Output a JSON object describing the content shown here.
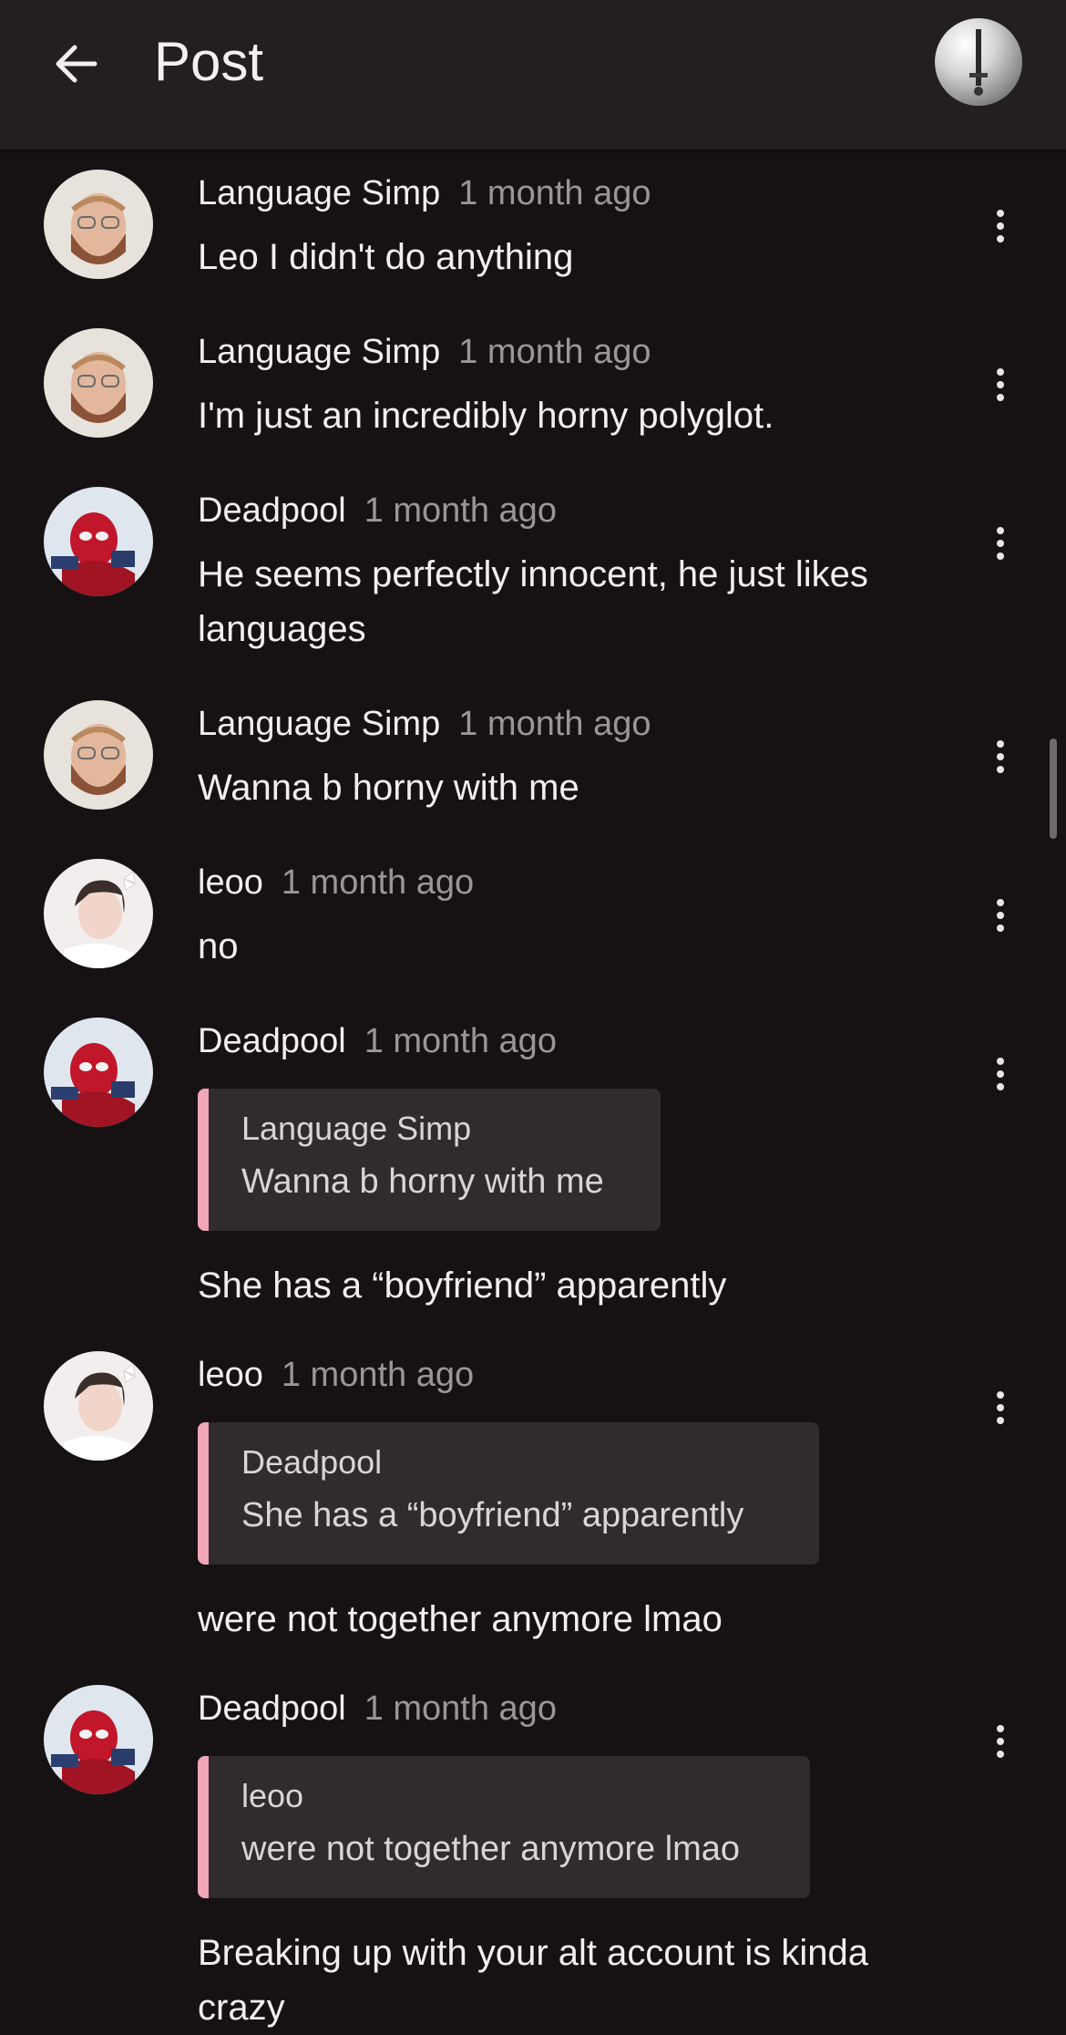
{
  "header": {
    "title": "Post",
    "back_icon": "arrow-left-icon",
    "avatar_icon": "user-avatar"
  },
  "comments": [
    {
      "author": "Language Simp",
      "time": "1 month ago",
      "text": "Leo I didn't do anything",
      "avatar": "bearded-man"
    },
    {
      "author": "Language Simp",
      "time": "1 month ago",
      "text": "I'm just an incredibly horny polyglot.",
      "avatar": "bearded-man"
    },
    {
      "author": "Deadpool",
      "time": "1 month ago",
      "text": "He seems perfectly innocent, he just likes languages",
      "avatar": "deadpool"
    },
    {
      "author": "Language Simp",
      "time": "1 month ago",
      "text": "Wanna b horny with me",
      "avatar": "bearded-man"
    },
    {
      "author": "leoo",
      "time": "1 month ago",
      "text": "no",
      "avatar": "girl-bow"
    },
    {
      "author": "Deadpool",
      "time": "1 month ago",
      "text": "She has a “boyfriend” apparently",
      "avatar": "deadpool",
      "quote": {
        "author": "Language Simp",
        "text": "Wanna b horny with me"
      }
    },
    {
      "author": "leoo",
      "time": "1 month ago",
      "text": "were not together anymore lmao",
      "avatar": "girl-bow",
      "quote": {
        "author": "Deadpool",
        "text": "She has a “boyfriend” apparently"
      }
    },
    {
      "author": "Deadpool",
      "time": "1 month ago",
      "text": "Breaking up with your alt account is kinda crazy",
      "avatar": "deadpool",
      "quote": {
        "author": "leoo",
        "text": "were not together anymore lmao"
      }
    }
  ],
  "colors": {
    "background": "#161214",
    "header": "#231f21",
    "quote_bar": "#f0a6b6",
    "quote_bg": "#302b2d",
    "timestamp": "#9b9597"
  }
}
